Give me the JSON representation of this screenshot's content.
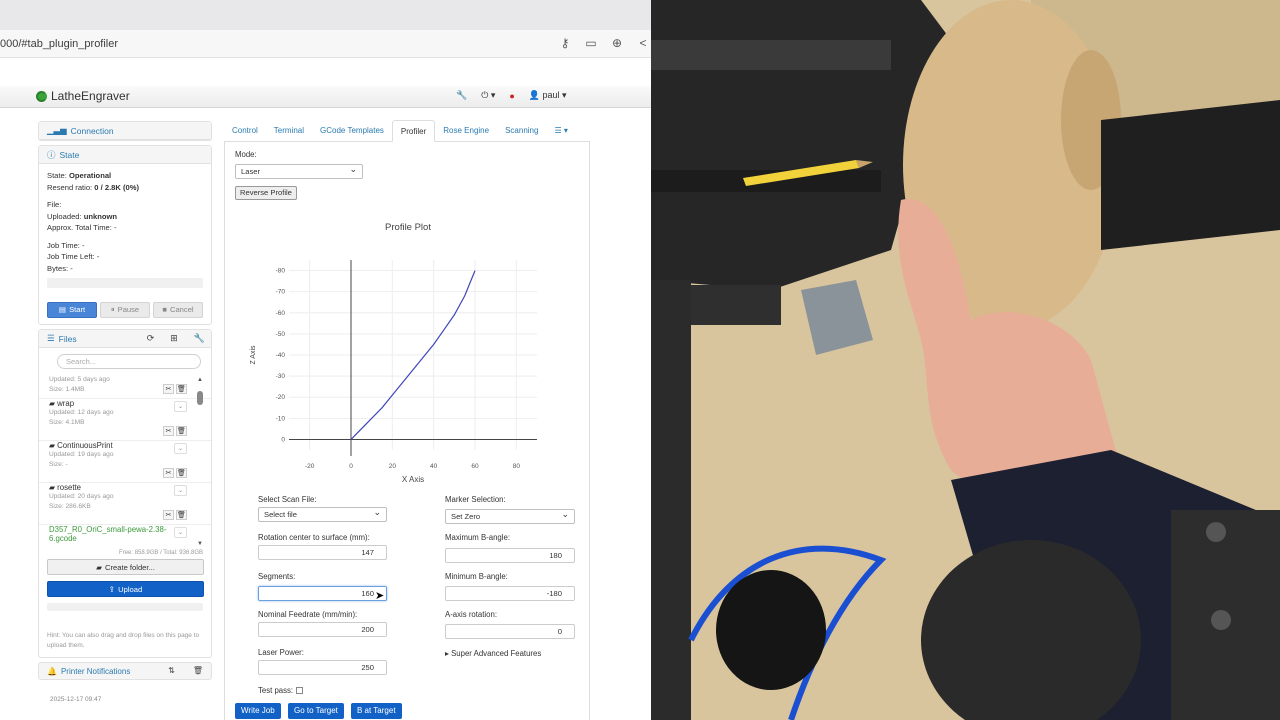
{
  "browser": {
    "url": "000/#tab_plugin_profiler"
  },
  "navbar": {
    "brand": "LatheEngraver",
    "user": "paul"
  },
  "connection": {
    "title": "Connection"
  },
  "state": {
    "title": "State",
    "state_label": "State:",
    "state_value": "Operational",
    "resend_label": "Resend ratio:",
    "resend_value": "0 / 2.8K (0%)",
    "file_label": "File:",
    "uploaded_label": "Uploaded:",
    "uploaded_value": "unknown",
    "approx_label": "Approx. Total Time:",
    "approx_value": "-",
    "job_time_label": "Job Time:",
    "job_time_value": "-",
    "job_left_label": "Job Time Left:",
    "job_left_value": "-",
    "bytes_label": "Bytes:",
    "bytes_value": "-",
    "start": "Start",
    "pause": "Pause",
    "cancel": "Cancel"
  },
  "files": {
    "title": "Files",
    "search_placeholder": "Search...",
    "top_updated": "Updated: 5 days ago",
    "top_size": "Size: 1.4MB",
    "items": [
      {
        "name": "wrap",
        "updated": "Updated: 12 days ago",
        "size": "Size: 4.1MB"
      },
      {
        "name": "ContinuousPrint",
        "updated": "Updated: 19 days ago",
        "size": "Size: -"
      },
      {
        "name": "rosette",
        "updated": "Updated: 20 days ago",
        "size": "Size: 286.6KB"
      },
      {
        "name": "D357_R0_OriC_small-pewa-2.38-6.gcode"
      }
    ],
    "free": "Free: 858.9GB / Total: 936.8GB",
    "create_folder": "Create folder...",
    "upload": "Upload",
    "hint": "Hint: You can also drag and drop files on this page to upload them."
  },
  "notifications": {
    "title": "Printer Notifications",
    "first_time": "2025-12-17 09:47"
  },
  "tabs": [
    "Control",
    "Terminal",
    "GCode Templates",
    "Profiler",
    "Rose Engine",
    "Scanning"
  ],
  "profiler": {
    "mode_label": "Mode:",
    "mode_value": "Laser",
    "reverse": "Reverse Profile",
    "plot_title": "Profile Plot",
    "scan_file_label": "Select Scan File:",
    "scan_file_value": "Select file",
    "rotation_label": "Rotation center to surface (mm):",
    "rotation_value": "147",
    "segments_label": "Segments:",
    "segments_value": "160",
    "feedrate_label": "Nominal Feedrate (mm/min):",
    "feedrate_value": "200",
    "laser_power_label": "Laser Power:",
    "laser_power_value": "250",
    "test_pass_label": "Test pass:",
    "marker_label": "Marker Selection:",
    "marker_value": "Set Zero",
    "max_b_label": "Maximum B-angle:",
    "max_b_value": "180",
    "min_b_label": "Minimum B-angle:",
    "min_b_value": "-180",
    "a_axis_label": "A-axis rotation:",
    "a_axis_value": "0",
    "super_advanced": "Super Advanced Features",
    "write_job": "Write Job",
    "go_to_target": "Go to Target",
    "b_at_target": "B at Target"
  },
  "chart_data": {
    "type": "line",
    "title": "Profile Plot",
    "xlabel": "X Axis",
    "ylabel": "Z Axis",
    "xlim": [
      -30,
      90
    ],
    "ylim": [
      -5,
      85
    ],
    "x_ticks": [
      -20,
      0,
      20,
      40,
      60,
      80
    ],
    "y_ticks": [
      0,
      -10,
      -20,
      -30,
      -40,
      -50,
      -60,
      -70,
      -80
    ],
    "series": [
      {
        "x": [
          0,
          5,
          10,
          15,
          20,
          25,
          30,
          35,
          40,
          45,
          50,
          55,
          60
        ],
        "y": [
          0,
          5,
          10,
          15,
          21,
          27,
          33,
          39,
          45,
          52,
          59,
          68,
          80
        ]
      }
    ]
  }
}
